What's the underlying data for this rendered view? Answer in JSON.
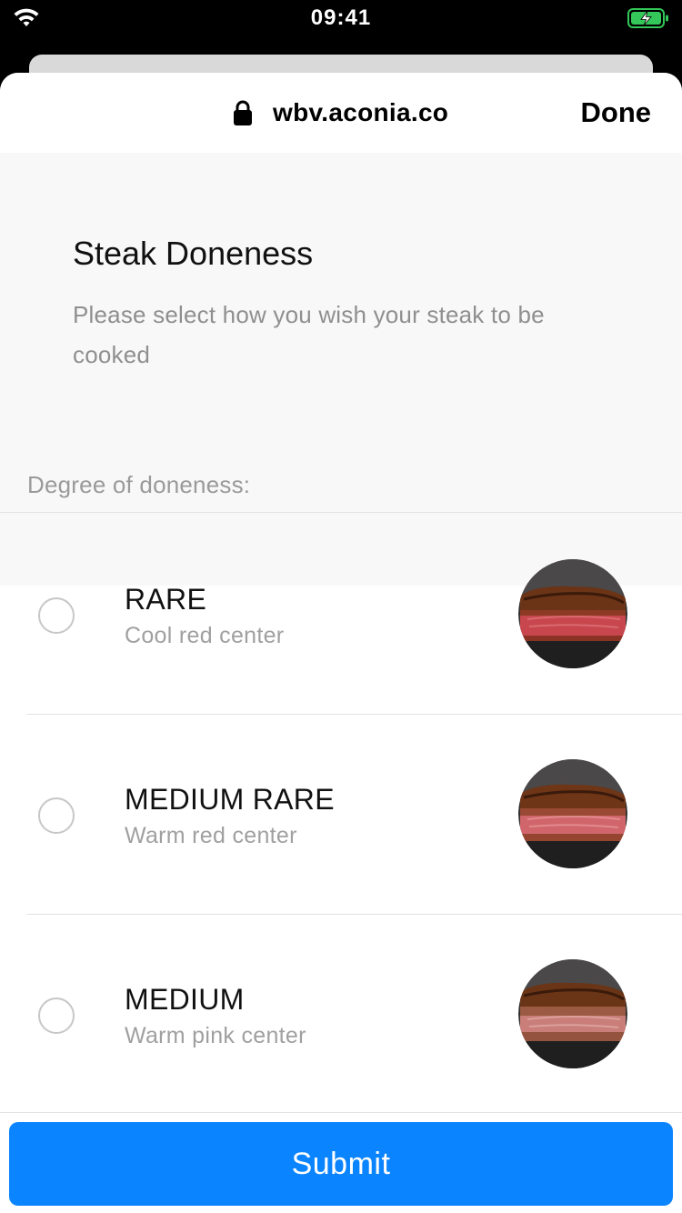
{
  "status_bar": {
    "time": "09:41"
  },
  "browser": {
    "url": "wbv.aconia.co",
    "done_label": "Done"
  },
  "form": {
    "title": "Steak Doneness",
    "description": "Please select how you wish your steak to be cooked",
    "section_label": "Degree of doneness:"
  },
  "options": [
    {
      "title": "RARE",
      "subtitle": "Cool red center",
      "selected": false
    },
    {
      "title": "MEDIUM RARE",
      "subtitle": "Warm red center",
      "selected": false
    },
    {
      "title": "MEDIUM",
      "subtitle": "Warm pink center",
      "selected": false
    }
  ],
  "submit": {
    "label": "Submit"
  },
  "colors": {
    "accent": "#0a84ff",
    "battery": "#34c759"
  }
}
